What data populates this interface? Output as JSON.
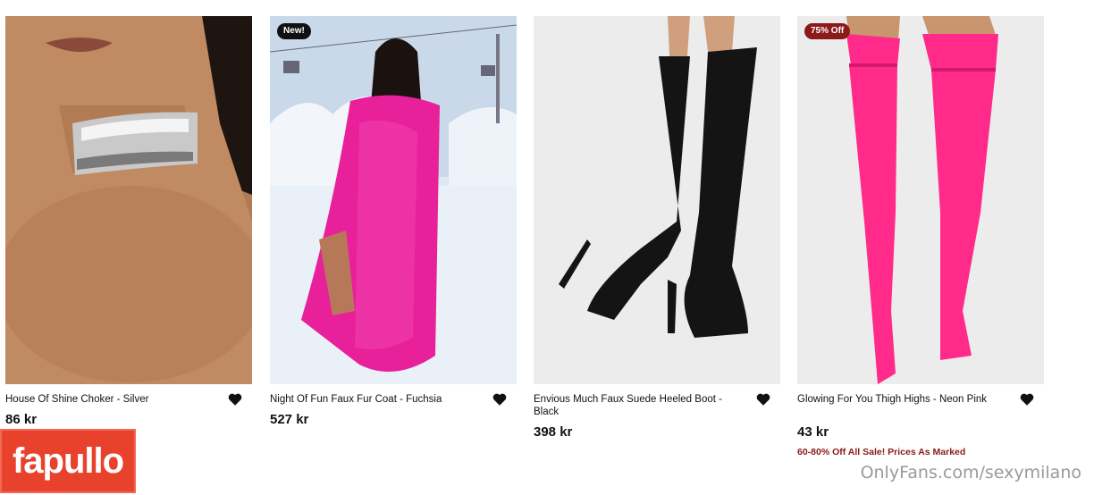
{
  "products": [
    {
      "name": "House Of Shine Choker - Silver",
      "price": "86 kr",
      "badge": ""
    },
    {
      "name": "Night Of Fun Faux Fur Coat - Fuchsia",
      "price": "527 kr",
      "badge": "New!"
    },
    {
      "name": "Envious Much Faux Suede Heeled Boot - Black",
      "price": "398 kr",
      "badge": ""
    },
    {
      "name": "Glowing For You Thigh Highs - Neon Pink",
      "price": "43 kr",
      "badge": "75% Off",
      "promo": "60-80% Off All Sale! Prices As Marked"
    }
  ],
  "logo": {
    "text": "fapullo"
  },
  "watermark": {
    "text": "OnlyFans.com/sexymilano"
  },
  "colors": {
    "sale_badge": "#8b1a1a",
    "logo_bg": "#e8422c",
    "fuchsia": "#e8209a",
    "neon_pink": "#ff2a8a"
  }
}
